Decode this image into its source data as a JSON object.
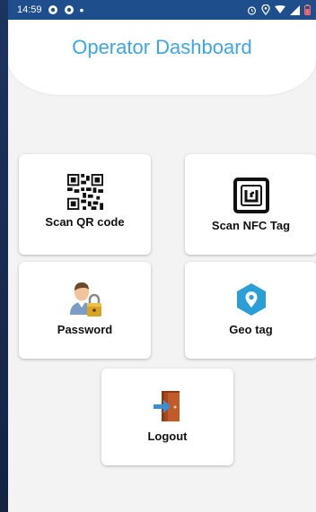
{
  "status_bar": {
    "time": "14:59",
    "dot": "•"
  },
  "header": {
    "title": "Operator Dashboard"
  },
  "tiles": {
    "scan_qr": "Scan QR code",
    "scan_nfc": "Scan NFC Tag",
    "password": "Password",
    "geo_tag": "Geo tag",
    "logout": "Logout"
  },
  "icons": {
    "scan_qr": "qr-code-icon",
    "scan_nfc": "nfc-tag-icon",
    "password": "user-lock-icon",
    "geo_tag": "location-pin-icon",
    "logout": "logout-door-icon"
  },
  "colors": {
    "status_bar": "#1f4e8c",
    "title": "#3ea6e6",
    "background": "#f3f3f3",
    "geo_pin": "#2a9fd6",
    "door": "#c25a2a"
  }
}
